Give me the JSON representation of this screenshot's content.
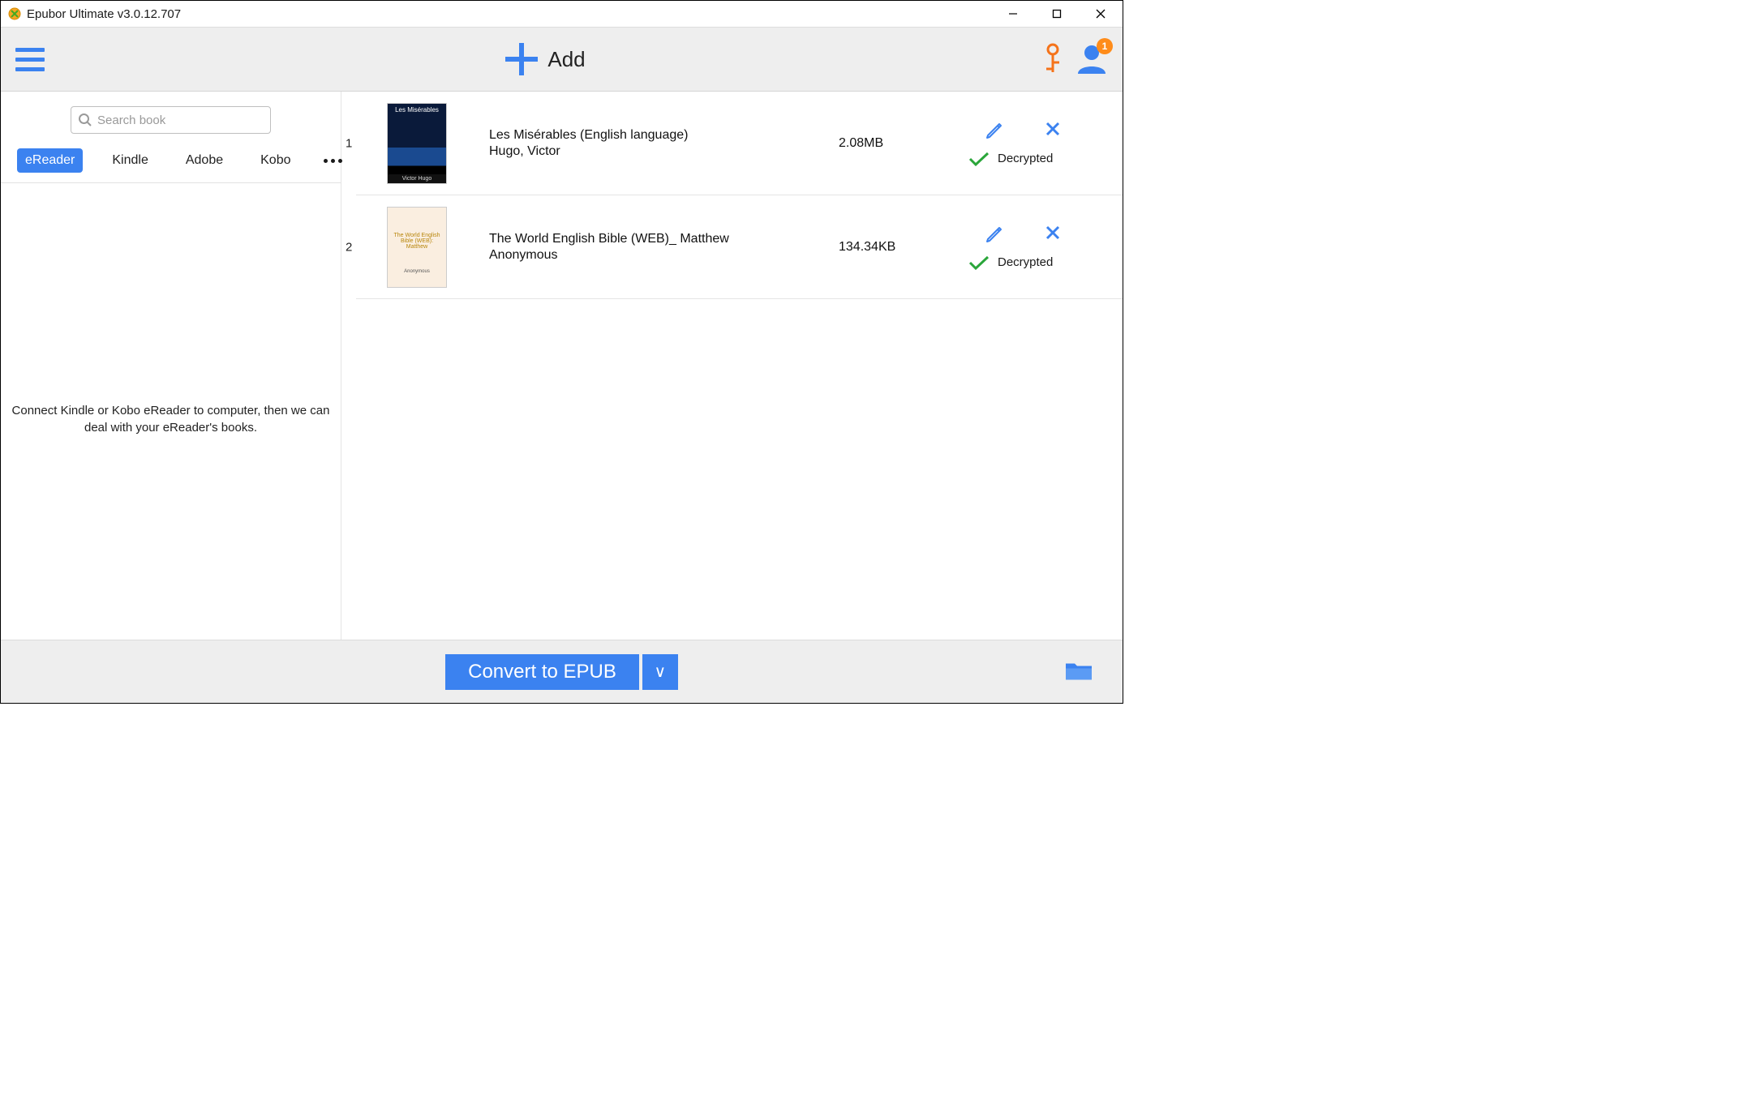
{
  "window": {
    "title": "Epubor Ultimate v3.0.12.707"
  },
  "toolbar": {
    "add_label": "Add",
    "user_badge": "1"
  },
  "sidebar": {
    "search_placeholder": "Search book",
    "tabs": [
      "eReader",
      "Kindle",
      "Adobe",
      "Kobo"
    ],
    "active_tab_index": 0,
    "message": "Connect Kindle or Kobo eReader to computer, then we can deal with your eReader's books."
  },
  "books": [
    {
      "index": "1",
      "title": "Les Misérables (English language)",
      "author": "Hugo, Victor",
      "size": "2.08MB",
      "status": "Decrypted",
      "cover_style": "blue",
      "cover_title": "Les Misérables",
      "cover_author": "Victor Hugo"
    },
    {
      "index": "2",
      "title": "The World English Bible (WEB)_ Matthew",
      "author": "Anonymous",
      "size": "134.34KB",
      "status": "Decrypted",
      "cover_style": "beige",
      "cover_title": "The World English Bible (WEB): Matthew",
      "cover_author": "Anonymous"
    }
  ],
  "footer": {
    "convert_label": "Convert to EPUB",
    "dropdown_glyph": "∨"
  }
}
